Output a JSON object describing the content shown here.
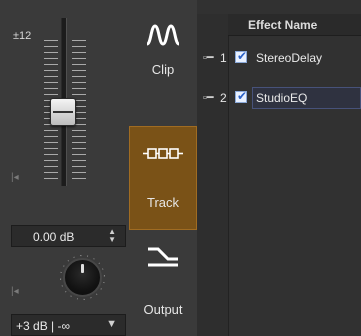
{
  "meter": {
    "range_label": "±12",
    "gain_value": "0.00 dB",
    "ceiling_value": "+3 dB | -∞"
  },
  "modes": [
    {
      "label": "Clip",
      "icon": "waveform-icon",
      "active": false
    },
    {
      "label": "Track",
      "icon": "track-chain-icon",
      "active": true
    },
    {
      "label": "Output",
      "icon": "output-routing-icon",
      "active": false
    }
  ],
  "effects_table": {
    "column_header": "Effect Name",
    "rows": [
      {
        "index": "1",
        "enabled": true,
        "name": "StereoDelay",
        "selected": false
      },
      {
        "index": "2",
        "enabled": true,
        "name": "StudioEQ",
        "selected": true
      }
    ]
  },
  "colors": {
    "active_mode_bg": "#7a5217",
    "panel_bg": "#3a3a3a",
    "table_bg": "#313131"
  }
}
